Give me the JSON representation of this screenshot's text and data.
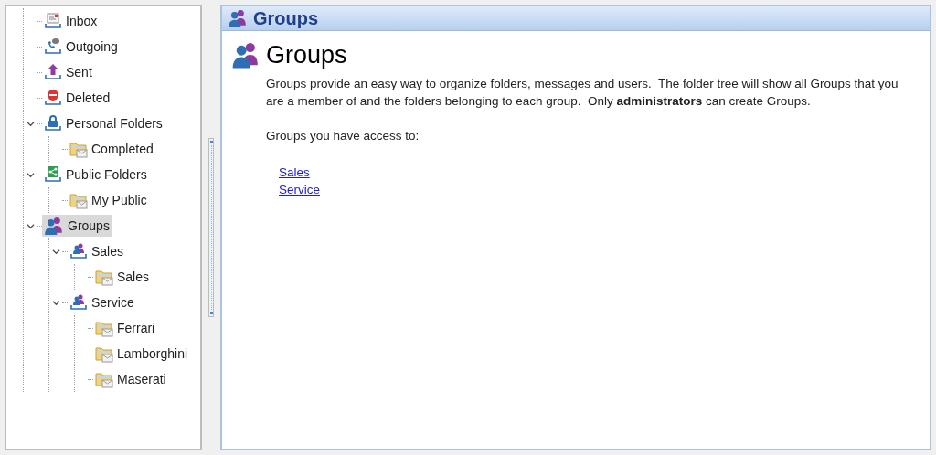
{
  "tree": [
    {
      "label": "Inbox",
      "kind": "inbox",
      "selected": false
    },
    {
      "label": "Outgoing",
      "kind": "outgoing",
      "selected": false
    },
    {
      "label": "Sent",
      "kind": "sent",
      "selected": false
    },
    {
      "label": "Deleted",
      "kind": "deleted",
      "selected": false
    },
    {
      "label": "Personal Folders",
      "kind": "personal",
      "selected": false,
      "expanded": true,
      "children": [
        {
          "label": "Completed",
          "kind": "folder",
          "selected": false
        }
      ]
    },
    {
      "label": "Public Folders",
      "kind": "public",
      "selected": false,
      "expanded": true,
      "children": [
        {
          "label": "My Public",
          "kind": "folder",
          "selected": false
        }
      ]
    },
    {
      "label": "Groups",
      "kind": "groups",
      "selected": true,
      "expanded": true,
      "children": [
        {
          "label": "Sales",
          "kind": "group",
          "selected": false,
          "expanded": true,
          "children": [
            {
              "label": "Sales",
              "kind": "folder",
              "selected": false
            }
          ]
        },
        {
          "label": "Service",
          "kind": "group",
          "selected": false,
          "expanded": true,
          "children": [
            {
              "label": "Ferrari",
              "kind": "folder",
              "selected": false
            },
            {
              "label": "Lamborghini",
              "kind": "folder",
              "selected": false
            },
            {
              "label": "Maserati",
              "kind": "folder",
              "selected": false
            }
          ]
        }
      ]
    }
  ],
  "header": {
    "title": "Groups"
  },
  "content": {
    "heading": "Groups",
    "description": "Groups provide an easy way to organize folders, messages and users.  The folder tree will show all Groups that you are a member of and the folders belonging to each group.  Only **administrators** can create Groups.",
    "access_label": "Groups you have access to:",
    "links": [
      "Sales",
      "Service"
    ]
  }
}
